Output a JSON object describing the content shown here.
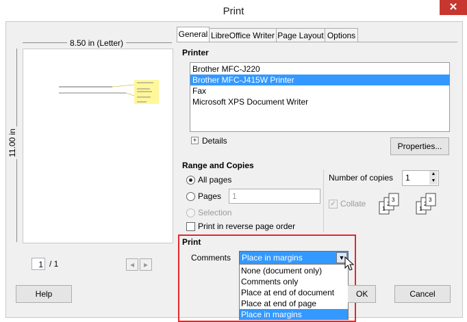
{
  "window": {
    "title": "Print",
    "close_glyph": "✕"
  },
  "preview": {
    "width_label": "8.50 in (Letter)",
    "height_label": "11.00 in",
    "page_number": "1",
    "page_total": "/ 1"
  },
  "tabs": [
    {
      "label": "General",
      "active": true
    },
    {
      "label": "LibreOffice Writer",
      "active": false
    },
    {
      "label": "Page Layout",
      "active": false
    },
    {
      "label": "Options",
      "active": false
    }
  ],
  "printer": {
    "heading": "Printer",
    "items": [
      "Brother MFC-J220",
      "Brother MFC-J415W Printer",
      "Fax",
      "Microsoft XPS Document Writer"
    ],
    "selected_index": 1,
    "details_label": "Details",
    "properties_label": "Properties..."
  },
  "range": {
    "heading": "Range and Copies",
    "all_pages_label": "All pages",
    "pages_label": "Pages",
    "pages_value": "1",
    "selection_label": "Selection",
    "reverse_label": "Print in reverse page order",
    "copies_label": "Number of copies",
    "copies_value": "1",
    "collate_label": "Collate"
  },
  "print_section": {
    "heading": "Print",
    "comments_label": "Comments",
    "comments_value": "Place in margins",
    "options": [
      "None (document only)",
      "Comments only",
      "Place at end of document",
      "Place at end of page",
      "Place in margins"
    ],
    "selected_index": 4
  },
  "buttons": {
    "help": "Help",
    "ok": "OK",
    "cancel": "Cancel"
  },
  "colors": {
    "highlight": "#3399ff",
    "annotation_box": "#e1262c",
    "close_bg": "#c7372f"
  }
}
